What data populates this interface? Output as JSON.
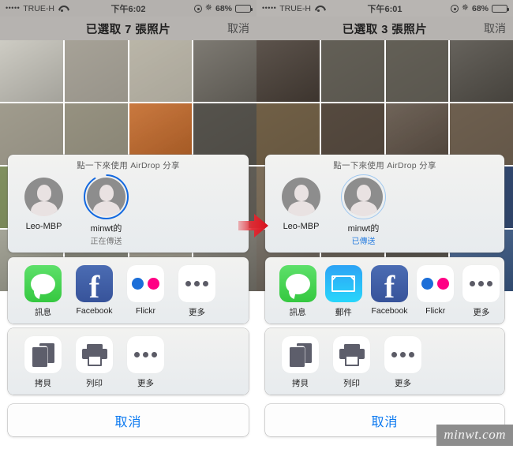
{
  "watermark": "minwt.com",
  "panels": [
    {
      "id": "left",
      "status_bar": {
        "signal_dots": "•••••",
        "carrier": "TRUE-H",
        "wifi_icon": "wifi-icon",
        "time": "下午6:02",
        "location_icon": "location-icon",
        "bluetooth_icon": "bluetooth-icon",
        "battery_percent": "68%",
        "battery_icon": "battery-icon"
      },
      "nav_bar": {
        "title": "已選取 7 張照片",
        "cancel": "取消"
      },
      "airdrop": {
        "hint": "點一下來使用 AirDrop 分享",
        "contacts": [
          {
            "name": "Leo-MBP",
            "status": "",
            "ring": "none",
            "avatar_icon": "avatar-icon"
          },
          {
            "name": "minwt的",
            "status": "正在傳送",
            "ring": "sending",
            "avatar_icon": "avatar-icon"
          }
        ]
      },
      "apps": [
        {
          "label": "訊息",
          "icon": "messages-icon"
        },
        {
          "label": "Facebook",
          "icon": "facebook-icon"
        },
        {
          "label": "Flickr",
          "icon": "flickr-icon"
        },
        {
          "label": "更多",
          "icon": "more-icon"
        }
      ],
      "actions": [
        {
          "label": "拷貝",
          "icon": "copy-icon"
        },
        {
          "label": "列印",
          "icon": "print-icon"
        },
        {
          "label": "更多",
          "icon": "more-icon"
        }
      ],
      "cancel_button": "取消"
    },
    {
      "id": "right",
      "status_bar": {
        "signal_dots": "•••••",
        "carrier": "TRUE-H",
        "wifi_icon": "wifi-icon",
        "time": "下午6:01",
        "location_icon": "location-icon",
        "bluetooth_icon": "bluetooth-icon",
        "battery_percent": "68%",
        "battery_icon": "battery-icon"
      },
      "nav_bar": {
        "title": "已選取 3 張照片",
        "cancel": "取消"
      },
      "airdrop": {
        "hint": "點一下來使用 AirDrop 分享",
        "contacts": [
          {
            "name": "Leo-MBP",
            "status": "",
            "ring": "none",
            "avatar_icon": "avatar-icon"
          },
          {
            "name": "minwt的",
            "status": "已傳送",
            "ring": "sent",
            "avatar_icon": "avatar-icon"
          }
        ]
      },
      "apps": [
        {
          "label": "訊息",
          "icon": "messages-icon"
        },
        {
          "label": "郵件",
          "icon": "mail-icon"
        },
        {
          "label": "Facebook",
          "icon": "facebook-icon"
        },
        {
          "label": "Flickr",
          "icon": "flickr-icon"
        },
        {
          "label": "更多",
          "icon": "more-icon"
        }
      ],
      "actions": [
        {
          "label": "拷貝",
          "icon": "copy-icon"
        },
        {
          "label": "列印",
          "icon": "print-icon"
        },
        {
          "label": "更多",
          "icon": "more-icon"
        }
      ],
      "cancel_button": "取消"
    }
  ],
  "colors": {
    "accent_blue": "#0a78f0",
    "airdrop_sending_ring": "#1268e0",
    "airdrop_sent_ring": "#9fc8f0",
    "sent_text": "#2b7fe0",
    "messages_green": "#35c840",
    "mail_blue": "#2da3f5",
    "facebook_blue": "#37539a",
    "flickr_blue": "#1b6ed8",
    "flickr_pink": "#ff0084",
    "arrow_red": "#e0202a"
  },
  "arrow": {
    "icon": "right-arrow-icon",
    "color": "#e0202a"
  },
  "photo_grids": {
    "left": [
      "#c8c6bd",
      "#b9b4a8",
      "#cfcabb",
      "#6f6b63",
      "#b2ad9d",
      "#a7a28f",
      "#c46a2a",
      "#5f5c55",
      "#8fa06a",
      "#9aa27e",
      "#b7b4a6",
      "#6e6a62",
      "#9a9a8c",
      "#8f8f82",
      "#a8a496",
      "#7a776e"
    ],
    "right": [
      "#4a4038",
      "#6e6a60",
      "#6e6a60",
      "#55514a",
      "#7d6a4e",
      "#5f5246",
      "#5f5246",
      "#7a6a58",
      "#8a7a64",
      "#8c7c6a",
      "#7a6c5c",
      "#38517d",
      "#6a6258",
      "#6e665c",
      "#5f5a52",
      "#3b5a86"
    ]
  }
}
